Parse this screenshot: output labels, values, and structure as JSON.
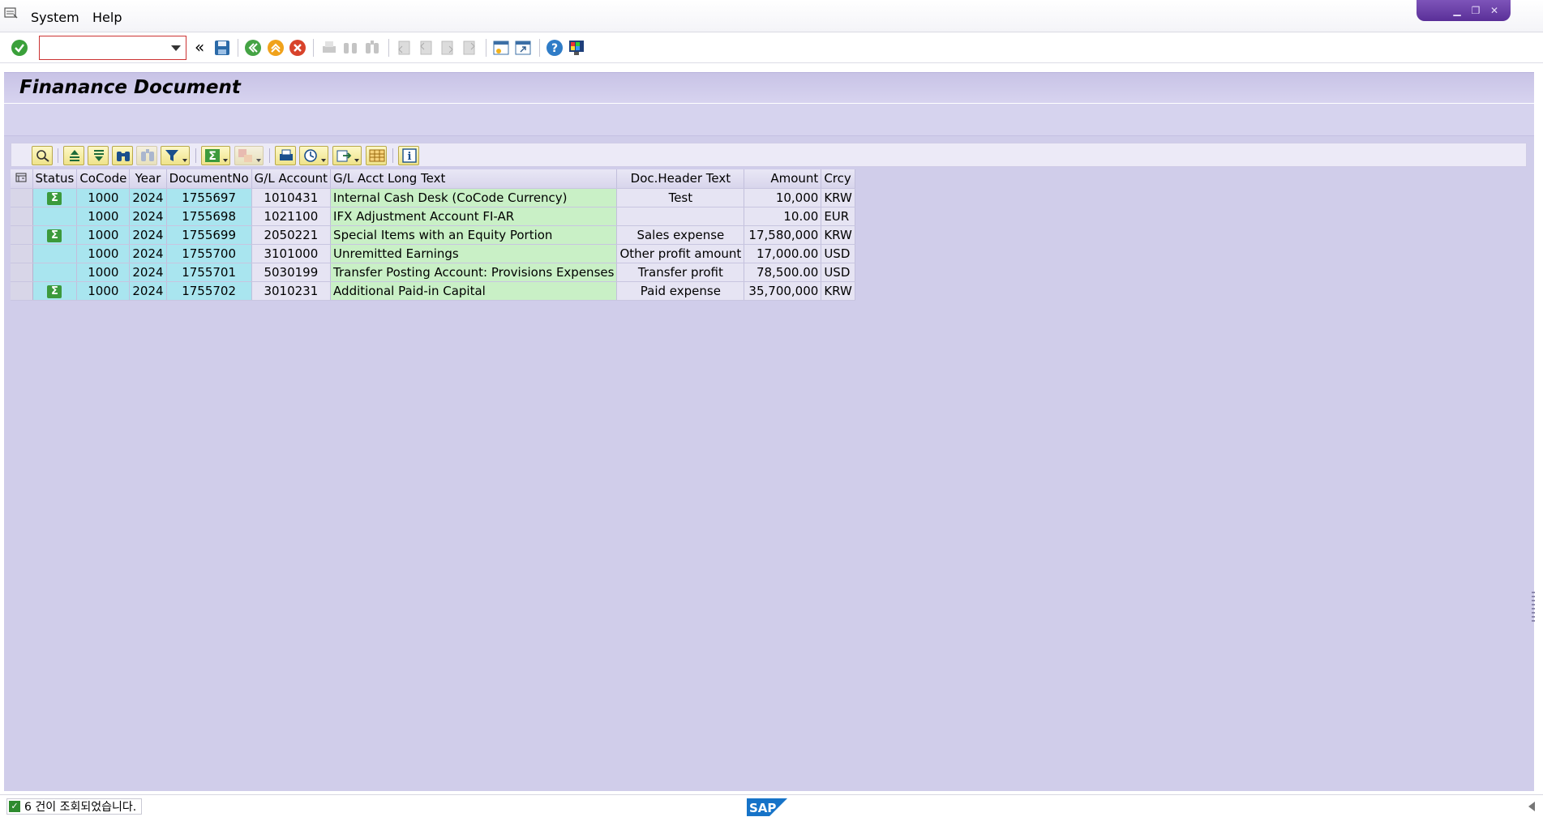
{
  "menu": {
    "items": [
      "System",
      "Help"
    ]
  },
  "toolbar": {
    "command_field_value": "",
    "icons": [
      "enter-icon",
      "save-icon",
      "back-icon",
      "exit-icon",
      "cancel-icon",
      "print-icon",
      "find-icon",
      "find-next-icon",
      "first-page-icon",
      "previous-page-icon",
      "next-page-icon",
      "last-page-icon",
      "create-session-icon",
      "shortcut-icon",
      "help-icon",
      "customize-layout-icon"
    ]
  },
  "page": {
    "title": "Finanance Document"
  },
  "alv_toolbar": {
    "icons": [
      "details-icon",
      "sort-ascending-icon",
      "sort-descending-icon",
      "find-icon",
      "find-next-icon",
      "filter-icon",
      "total-icon",
      "subtotal-icon",
      "print-preview-icon",
      "views-icon",
      "export-icon",
      "layout-icon",
      "info-icon"
    ]
  },
  "grid": {
    "columns": [
      "Status",
      "CoCode",
      "Year",
      "DocumentNo",
      "G/L Account",
      "G/L Acct Long Text",
      "Doc.Header Text",
      "Amount",
      "Crcy"
    ],
    "status_symbol": "Σ",
    "rows": [
      {
        "status": true,
        "cocode": "1000",
        "year": "2024",
        "docno": "1755697",
        "glacct": "1010431",
        "longtext": "Internal Cash Desk (CoCode Currency)",
        "header": "Test",
        "amount": "10,000",
        "crcy": "KRW"
      },
      {
        "status": false,
        "cocode": "1000",
        "year": "2024",
        "docno": "1755698",
        "glacct": "1021100",
        "longtext": "IFX Adjustment Account FI-AR",
        "header": "",
        "amount": "10.00",
        "crcy": "EUR"
      },
      {
        "status": true,
        "cocode": "1000",
        "year": "2024",
        "docno": "1755699",
        "glacct": "2050221",
        "longtext": "Special Items with an Equity Portion",
        "header": "Sales expense",
        "amount": "17,580,000",
        "crcy": "KRW"
      },
      {
        "status": false,
        "cocode": "1000",
        "year": "2024",
        "docno": "1755700",
        "glacct": "3101000",
        "longtext": "Unremitted Earnings",
        "header": "Other profit amount",
        "amount": "17,000.00",
        "crcy": "USD"
      },
      {
        "status": false,
        "cocode": "1000",
        "year": "2024",
        "docno": "1755701",
        "glacct": "5030199",
        "longtext": "Transfer Posting Account: Provisions Expenses",
        "header": "Transfer profit",
        "amount": "78,500.00",
        "crcy": "USD"
      },
      {
        "status": true,
        "cocode": "1000",
        "year": "2024",
        "docno": "1755702",
        "glacct": "3010231",
        "longtext": "Additional Paid-in Capital",
        "header": "Paid expense",
        "amount": "35,700,000",
        "crcy": "KRW"
      }
    ]
  },
  "statusbar": {
    "message": "6 건이 조회되었습니다.",
    "logo_text": "SAP"
  },
  "colors": {
    "content_bg": "#d0cdea",
    "key_cell": "#a9e5ef",
    "text_cell": "#c9f0c6",
    "window_controls": "#5a2f98"
  }
}
